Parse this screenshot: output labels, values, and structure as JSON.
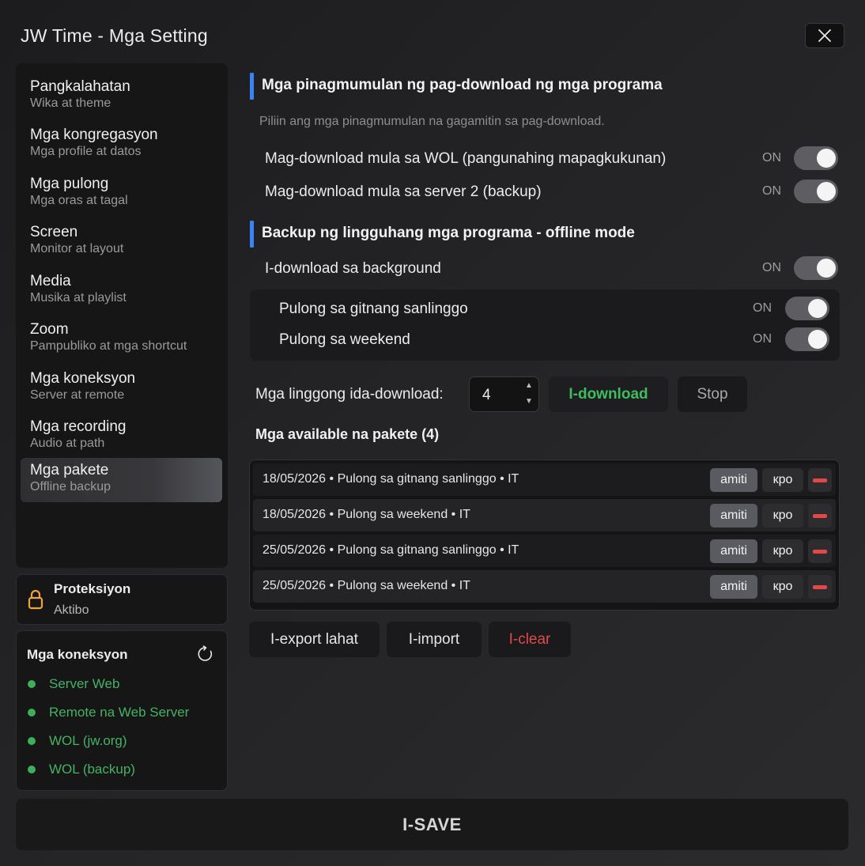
{
  "window": {
    "title": "JW Time - Mga Setting",
    "close_icon": "close-icon"
  },
  "sidebar": {
    "items": [
      {
        "label": "Pangkalahatan",
        "sub": "Wika at theme"
      },
      {
        "label": "Mga kongregasyon",
        "sub": "Mga profile at datos"
      },
      {
        "label": "Mga pulong",
        "sub": "Mga oras at tagal"
      },
      {
        "label": "Screen",
        "sub": "Monitor at layout"
      },
      {
        "label": "Media",
        "sub": "Musika at playlist"
      },
      {
        "label": "Zoom",
        "sub": "Pampubliko at mga shortcut"
      },
      {
        "label": "Mga koneksyon",
        "sub": "Server at remote"
      },
      {
        "label": "Mga recording",
        "sub": "Audio at path"
      },
      {
        "label": "Mga pakete",
        "sub": "Offline backup",
        "active": true
      }
    ]
  },
  "protection": {
    "title": "Proteksiyon",
    "status": "Aktibo",
    "icon": "lock-icon",
    "icon_color": "#f0a23c"
  },
  "connections": {
    "title": "Mga koneksyon",
    "refresh_icon": "refresh-icon",
    "status_color": "#3fae5c",
    "items": [
      "Server Web",
      "Remote na Web Server",
      "WOL (jw.org)",
      "WOL (backup)"
    ]
  },
  "sources": {
    "heading": "Mga pinagmumulan ng pag-download ng mga programa",
    "description": "Piliin ang mga pinagmumulan na gagamitin sa pag-download.",
    "options": [
      {
        "label": "Mag-download mula sa WOL (pangunahing mapagkukunan)",
        "state": "ON"
      },
      {
        "label": "Mag-download mula sa server 2 (backup)",
        "state": "ON"
      }
    ]
  },
  "backup": {
    "heading": "Backup ng lingguhang mga programa - offline mode",
    "background": {
      "label": "I-download sa background",
      "state": "ON"
    },
    "meetings": [
      {
        "label": "Pulong sa gitnang sanlinggo",
        "state": "ON"
      },
      {
        "label": "Pulong sa weekend",
        "state": "ON"
      }
    ],
    "weeks_label": "Mga linggong ida-download:",
    "weeks_value": "4",
    "download_label": "I-download",
    "stop_label": "Stop"
  },
  "packages": {
    "title": "Mga available na pakete (4)",
    "items": [
      {
        "text": "18/05/2026 • Pulong sa gitnang sanlinggo • IT"
      },
      {
        "text": "18/05/2026 • Pulong sa weekend • IT"
      },
      {
        "text": "25/05/2026 • Pulong sa gitnang sanlinggo • IT"
      },
      {
        "text": "25/05/2026 • Pulong sa weekend • IT"
      }
    ],
    "apply_label": "amiti",
    "export_one_label": "кро",
    "delete_icon": "minus-icon",
    "delete_color": "#e34848"
  },
  "actions": {
    "export_all": "I-export lahat",
    "import": "I-import",
    "clear": "I-clear",
    "save": "I-SAVE"
  },
  "colors": {
    "accent_blue": "#3b82f6",
    "green": "#3dbd5f",
    "red": "#e24a4a"
  }
}
